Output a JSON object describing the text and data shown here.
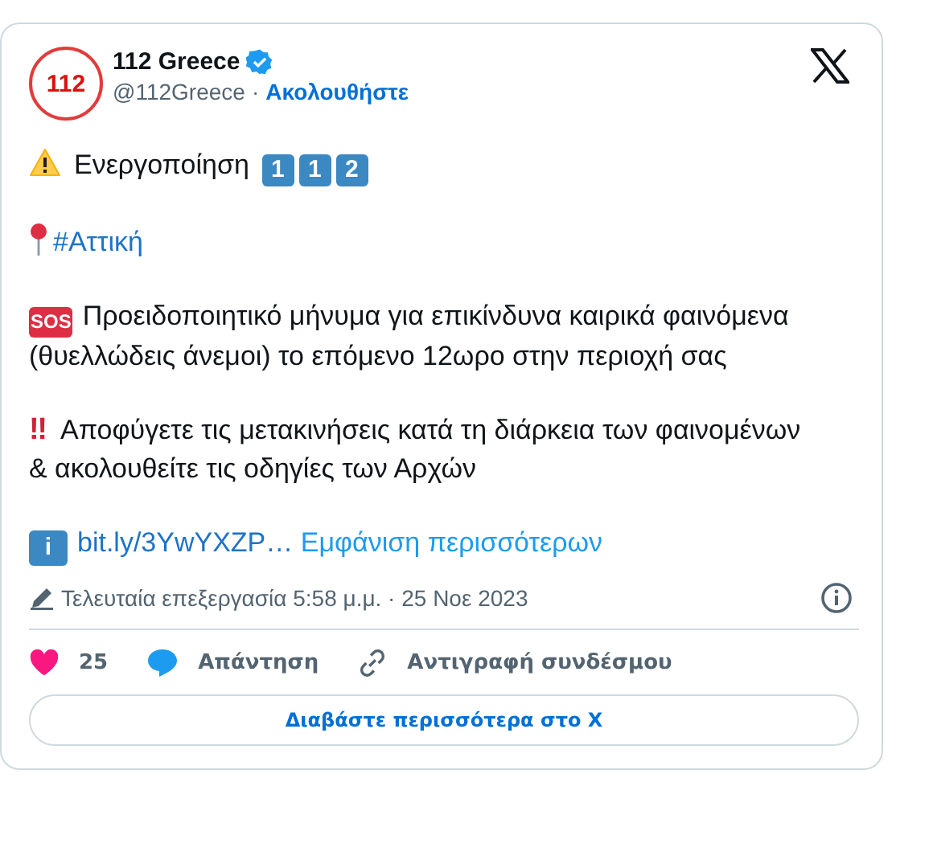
{
  "author": {
    "name": "112 Greece",
    "verified": true,
    "handle": "@112Greece",
    "separator": "·",
    "follow": "Ακολουθήστε",
    "avatar_text": "112"
  },
  "paragraphs": [
    {
      "kind": "warning",
      "text": "Ενεργοποίηση",
      "keycaps": [
        "1",
        "1",
        "2"
      ]
    },
    {
      "kind": "pin",
      "hashtag": "#Αττική"
    },
    {
      "kind": "sos",
      "badge": "SOS",
      "text": "Προειδοποιητικό μήνυμα για επικίνδυνα καιρικά φαινόμενα (θυελλώδεις άνεμοι) το επόμενο 12ωρο στην περιοχή σας"
    },
    {
      "kind": "bang",
      "badge": "‼",
      "text": "Αποφύγετε τις μετακινήσεις κατά τη διάρκεια των φαινομένων & ακολουθείτε τις οδηγίες των Αρχών"
    },
    {
      "kind": "info",
      "badge": "i",
      "link": "bit.ly/3YwYXZP…",
      "more": "Εμφάνιση περισσότερων"
    }
  ],
  "meta": "Τελευταία επεξεργασία 5:58 μ.μ. · 25 Νοε 2023",
  "actions": {
    "likes": "25",
    "reply": "Απάντηση",
    "copy": "Αντιγραφή συνδέσμου"
  },
  "read_more": "Διαβάστε περισσότερα στο X"
}
